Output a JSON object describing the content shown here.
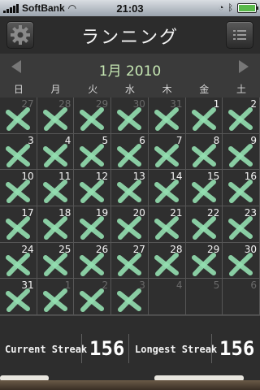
{
  "status_bar": {
    "carrier": "SoftBank",
    "time": "21:03"
  },
  "header": {
    "title": "ランニング",
    "settings_icon": "gear-icon",
    "list_icon": "list-icon"
  },
  "calendar": {
    "month_label": "1月 2010",
    "prev_icon": "left-arrow-icon",
    "next_icon": "right-arrow-icon",
    "weekdays": [
      "日",
      "月",
      "火",
      "水",
      "木",
      "金",
      "土"
    ],
    "cells": [
      {
        "day": "27",
        "other": true,
        "done": true
      },
      {
        "day": "28",
        "other": true,
        "done": true
      },
      {
        "day": "29",
        "other": true,
        "done": true
      },
      {
        "day": "30",
        "other": true,
        "done": true
      },
      {
        "day": "31",
        "other": true,
        "done": true
      },
      {
        "day": "1",
        "other": false,
        "done": true
      },
      {
        "day": "2",
        "other": false,
        "done": true
      },
      {
        "day": "3",
        "other": false,
        "done": true
      },
      {
        "day": "4",
        "other": false,
        "done": true
      },
      {
        "day": "5",
        "other": false,
        "done": true
      },
      {
        "day": "6",
        "other": false,
        "done": true
      },
      {
        "day": "7",
        "other": false,
        "done": true
      },
      {
        "day": "8",
        "other": false,
        "done": true
      },
      {
        "day": "9",
        "other": false,
        "done": true
      },
      {
        "day": "10",
        "other": false,
        "done": true
      },
      {
        "day": "11",
        "other": false,
        "done": true
      },
      {
        "day": "12",
        "other": false,
        "done": true
      },
      {
        "day": "13",
        "other": false,
        "done": true
      },
      {
        "day": "14",
        "other": false,
        "done": true
      },
      {
        "day": "15",
        "other": false,
        "done": true
      },
      {
        "day": "16",
        "other": false,
        "done": true
      },
      {
        "day": "17",
        "other": false,
        "done": true
      },
      {
        "day": "18",
        "other": false,
        "done": true
      },
      {
        "day": "19",
        "other": false,
        "done": true
      },
      {
        "day": "20",
        "other": false,
        "done": true
      },
      {
        "day": "21",
        "other": false,
        "done": true
      },
      {
        "day": "22",
        "other": false,
        "done": true
      },
      {
        "day": "23",
        "other": false,
        "done": true
      },
      {
        "day": "24",
        "other": false,
        "done": true
      },
      {
        "day": "25",
        "other": false,
        "done": true
      },
      {
        "day": "26",
        "other": false,
        "done": true
      },
      {
        "day": "27",
        "other": false,
        "done": true
      },
      {
        "day": "28",
        "other": false,
        "done": true
      },
      {
        "day": "29",
        "other": false,
        "done": true
      },
      {
        "day": "30",
        "other": false,
        "done": true
      },
      {
        "day": "31",
        "other": false,
        "done": true
      },
      {
        "day": "1",
        "other": true,
        "done": true
      },
      {
        "day": "2",
        "other": true,
        "done": true
      },
      {
        "day": "3",
        "other": true,
        "done": true
      },
      {
        "day": "4",
        "other": true,
        "done": false
      },
      {
        "day": "5",
        "other": true,
        "done": false
      },
      {
        "day": "6",
        "other": true,
        "done": false
      }
    ]
  },
  "streaks": {
    "current_label": "Current Streak",
    "current_value": "156",
    "longest_label": "Longest Streak",
    "longest_value": "156"
  },
  "colors": {
    "chalk_green": "#93dfb0"
  }
}
